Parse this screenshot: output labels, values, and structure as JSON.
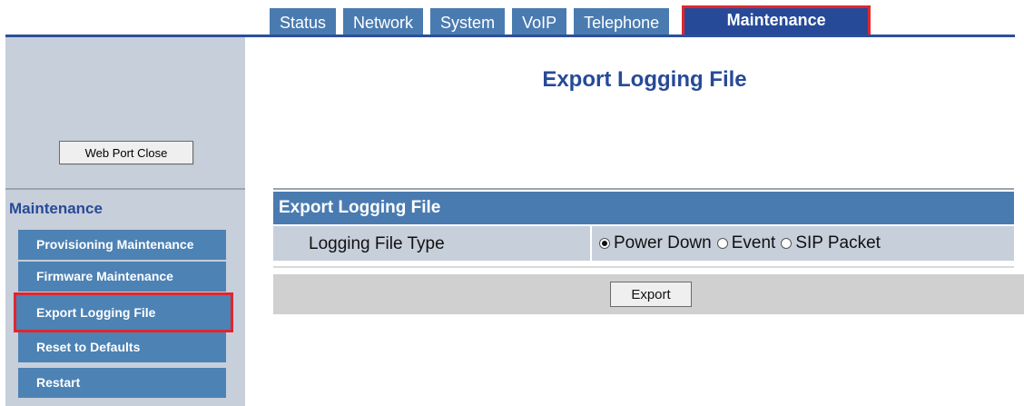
{
  "tabs": [
    {
      "label": "Status"
    },
    {
      "label": "Network"
    },
    {
      "label": "System"
    },
    {
      "label": "VoIP"
    },
    {
      "label": "Telephone"
    },
    {
      "label": "Maintenance",
      "active": true
    }
  ],
  "sidebar": {
    "web_port_button": "Web Port Close",
    "menu_title": "Maintenance",
    "items": [
      {
        "label": "Provisioning Maintenance"
      },
      {
        "label": "Firmware Maintenance"
      },
      {
        "label": "Export Logging File",
        "selected": true
      },
      {
        "label": "Reset to Defaults"
      },
      {
        "label": "Restart"
      }
    ]
  },
  "main": {
    "title": "Export Logging File",
    "section_header": "Export Logging File",
    "field_label": "Logging File Type",
    "options": [
      {
        "label": "Power Down",
        "checked": true
      },
      {
        "label": "Event",
        "checked": false
      },
      {
        "label": "SIP Packet",
        "checked": false
      }
    ],
    "export_button": "Export"
  },
  "colors": {
    "tab": "#4a7bb0",
    "tab_active": "#274a98",
    "highlight": "#e0262e",
    "sidebar_bg": "#c7cfdb",
    "menu_item": "#4d82b4"
  }
}
